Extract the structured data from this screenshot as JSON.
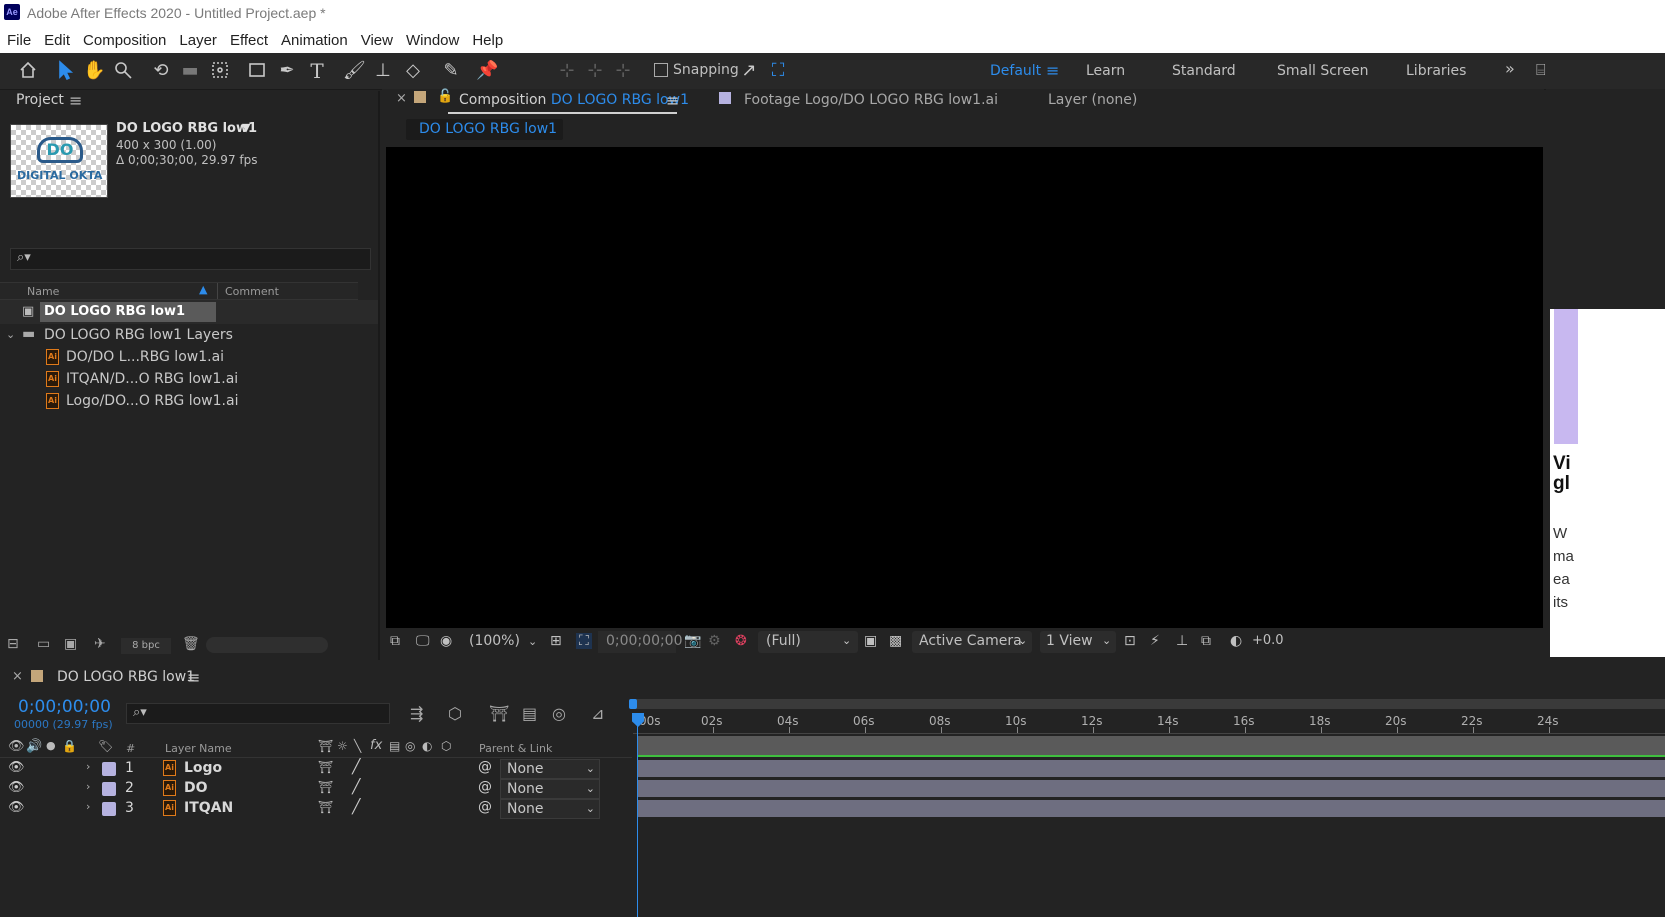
{
  "window": {
    "title": "Adobe After Effects 2020 - Untitled Project.aep *",
    "app_badge": "Ae"
  },
  "menu": [
    "File",
    "Edit",
    "Composition",
    "Layer",
    "Effect",
    "Animation",
    "View",
    "Window",
    "Help"
  ],
  "toolbar": {
    "snapping": "Snapping",
    "workspaces": [
      "Default",
      "Learn",
      "Standard",
      "Small Screen",
      "Libraries"
    ],
    "active_workspace": "Default"
  },
  "project": {
    "title": "Project",
    "item_name": "DO LOGO RBG low1",
    "item_dims": "400 x 300 (1.00)",
    "item_duration": "Δ 0;00;30;00, 29.97 fps",
    "thumb_text": "DO",
    "thumb_caption": "DIGITAL OKTA",
    "columns": {
      "name": "Name",
      "comment": "Comment"
    },
    "rows": [
      {
        "label": "DO LOGO RBG low1",
        "kind": "comp"
      },
      {
        "label": "DO LOGO RBG low1 Layers",
        "kind": "folder"
      },
      {
        "label": "DO/DO L...RBG low1.ai",
        "kind": "ai"
      },
      {
        "label": "ITQAN/D...O RBG low1.ai",
        "kind": "ai"
      },
      {
        "label": "Logo/DO...O RBG low1.ai",
        "kind": "ai"
      }
    ],
    "bpc": "8 bpc"
  },
  "comp_panel": {
    "tab_comp_prefix": "Composition",
    "tab_comp_name": "DO LOGO RBG low1",
    "tab_footage": "Footage  Logo/DO LOGO RBG low1.ai",
    "tab_layer": "Layer  (none)",
    "subtab": "DO LOGO RBG low1",
    "zoom": "(100%)",
    "timecode": "0;00;00;00",
    "resolution": "(Full)",
    "camera": "Active Camera",
    "views": "1 View",
    "exposure": "+0.0"
  },
  "right_panel": {
    "heading": [
      "Vi",
      "gl"
    ],
    "body": [
      "W",
      "ma",
      "ea",
      "its"
    ]
  },
  "timeline": {
    "tab": "DO LOGO RBG low1",
    "timecode": "0;00;00;00",
    "frame_info": "00000 (29.97 fps)",
    "columns": {
      "num": "#",
      "layer_name": "Layer Name",
      "parent": "Parent & Link"
    },
    "layers": [
      {
        "num": "1",
        "name": "Logo",
        "parent": "None"
      },
      {
        "num": "2",
        "name": "DO",
        "parent": "None"
      },
      {
        "num": "3",
        "name": "ITQAN",
        "parent": "None"
      }
    ],
    "ruler": [
      "00s",
      "02s",
      "04s",
      "06s",
      "08s",
      "10s",
      "12s",
      "14s",
      "16s",
      "18s",
      "20s",
      "22s",
      "24s"
    ]
  },
  "colors": {
    "accent": "#2d8ceb",
    "layer_label": "#b6b2e0",
    "ai_orange": "#e07a1a"
  }
}
